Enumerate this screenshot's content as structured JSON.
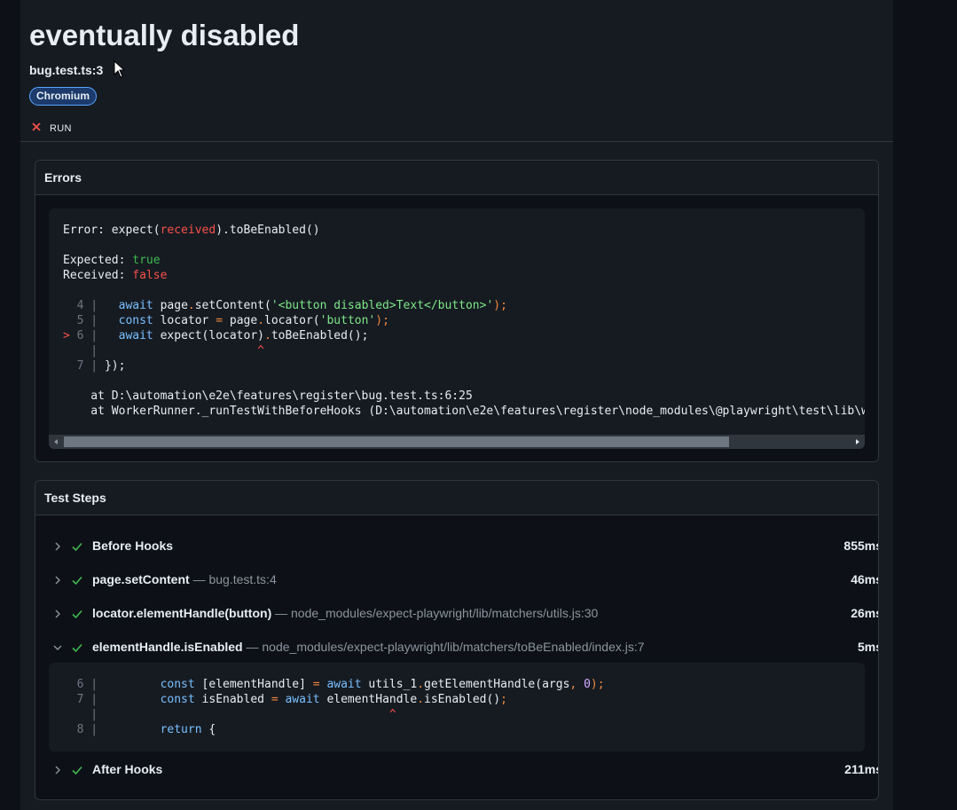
{
  "header": {
    "title": "eventually disabled",
    "location": "bug.test.ts:3",
    "project_badge": "Chromium",
    "run_tab_label": "RUN"
  },
  "errors": {
    "heading": "Errors",
    "message_prefix": "Error: expect(",
    "message_received": "received",
    "message_suffix": ").toBeEnabled()",
    "expected_label": "Expected: ",
    "expected_value": "true",
    "received_label": "Received: ",
    "received_value": "false",
    "snippet": [
      {
        "gutter": "  4 | ",
        "parts": [
          [
            "kw",
            "  await "
          ],
          [
            "",
            "page"
          ],
          [
            "orng",
            "."
          ],
          [
            "",
            "setContent("
          ],
          [
            "str",
            "'<button disabled>Text</button>'"
          ],
          [
            "orng",
            ");"
          ]
        ]
      },
      {
        "gutter": "  5 | ",
        "parts": [
          [
            "kw",
            "  const "
          ],
          [
            "",
            "locator "
          ],
          [
            "orng",
            "= "
          ],
          [
            "",
            "page"
          ],
          [
            "orng",
            "."
          ],
          [
            "",
            "locator("
          ],
          [
            "str",
            "'button'"
          ],
          [
            "orng",
            ");"
          ]
        ]
      },
      {
        "gutter": "> 6 | ",
        "parts": [
          [
            "kw",
            "  await "
          ],
          [
            "",
            "expect(locator)"
          ],
          [
            "orng",
            "."
          ],
          [
            "",
            "toBeEnabled();"
          ]
        ]
      },
      {
        "gutter": "    | ",
        "parts": [
          [
            "red",
            "                      ^"
          ]
        ]
      },
      {
        "gutter": "  7 | ",
        "parts": [
          [
            "",
            "});"
          ]
        ]
      }
    ],
    "stack": [
      "    at D:\\automation\\e2e\\features\\register\\bug.test.ts:6:25",
      "    at WorkerRunner._runTestWithBeforeHooks (D:\\automation\\e2e\\features\\register\\node_modules\\@playwright\\test\\lib\\workerRunner.js"
    ]
  },
  "steps": {
    "heading": "Test Steps",
    "items": [
      {
        "name": "Before Hooks",
        "source": "",
        "duration": "855ms",
        "expanded": false
      },
      {
        "name": "page.setContent",
        "source": " — bug.test.ts:4",
        "duration": "46ms",
        "expanded": false
      },
      {
        "name": "locator.elementHandle(button)",
        "source": " — node_modules/expect-playwright/lib/matchers/utils.js:30",
        "duration": "26ms",
        "expanded": false
      },
      {
        "name": "elementHandle.isEnabled",
        "source": " — node_modules/expect-playwright/lib/matchers/toBeEnabled/index.js:7",
        "duration": "5ms",
        "expanded": true
      },
      {
        "name": "After Hooks",
        "source": "",
        "duration": "211ms",
        "expanded": false
      }
    ],
    "subcode": [
      {
        "gutter": "  6 | ",
        "parts": [
          [
            "kw",
            "        const "
          ],
          [
            "",
            "[elementHandle] "
          ],
          [
            "orng",
            "= "
          ],
          [
            "kw",
            "await "
          ],
          [
            "",
            "utils_1"
          ],
          [
            "orng",
            "."
          ],
          [
            "",
            "getElementHandle(args"
          ],
          [
            "orng",
            ", "
          ],
          [
            "pur",
            "0"
          ],
          [
            "orng",
            ");"
          ]
        ]
      },
      {
        "gutter": "  7 | ",
        "parts": [
          [
            "kw",
            "        const "
          ],
          [
            "",
            "isEnabled "
          ],
          [
            "orng",
            "= "
          ],
          [
            "kw",
            "await "
          ],
          [
            "",
            "elementHandle"
          ],
          [
            "orng",
            "."
          ],
          [
            "",
            "isEnabled()"
          ],
          [
            "orng",
            ";"
          ]
        ]
      },
      {
        "gutter": "    | ",
        "parts": [
          [
            "red",
            "                                         ^"
          ]
        ]
      },
      {
        "gutter": "  8 | ",
        "parts": [
          [
            "kw",
            "        return "
          ],
          [
            "",
            "{"
          ]
        ]
      }
    ]
  },
  "colors": {
    "check": "#3fb950",
    "fail": "#f85149",
    "badge_border": "#58a6ff"
  }
}
